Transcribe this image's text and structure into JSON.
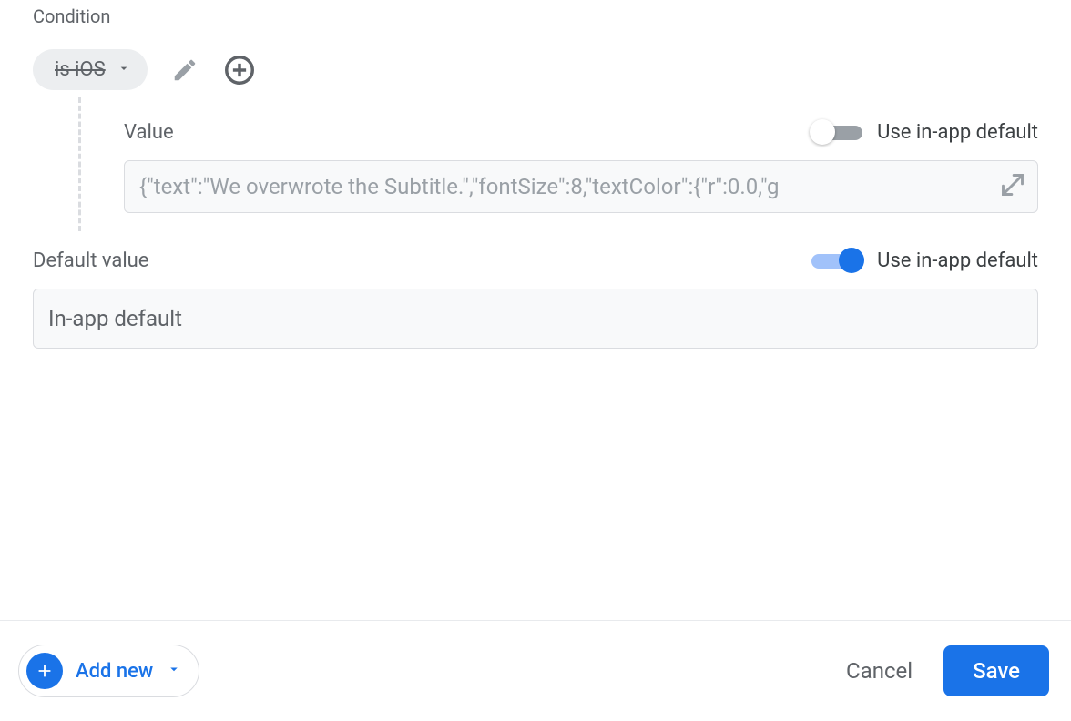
{
  "condition": {
    "label": "Condition",
    "chip_text": "is iOS"
  },
  "value_section": {
    "label": "Value",
    "toggle_label": "Use in-app default",
    "toggle_on": false,
    "input_value": "{\"text\":\"We overwrote the Subtitle.\",\"fontSize\":8,\"textColor\":{\"r\":0.0,\"g"
  },
  "default_section": {
    "label": "Default value",
    "toggle_label": "Use in-app default",
    "toggle_on": true,
    "input_value": "In-app default"
  },
  "footer": {
    "add_new_label": "Add new",
    "cancel_label": "Cancel",
    "save_label": "Save"
  }
}
